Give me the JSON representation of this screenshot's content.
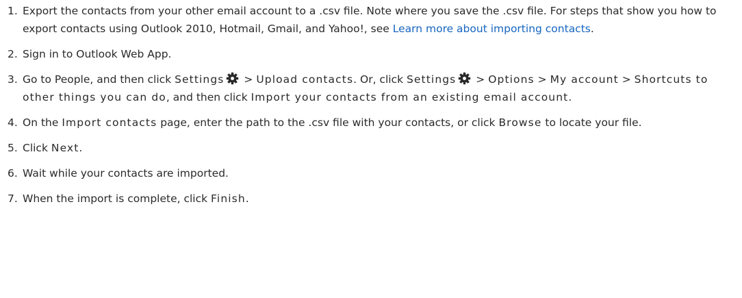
{
  "steps": [
    {
      "num": "1.",
      "text": "Export the contacts from your other email account to a .csv file. Note where you save the .csv file. For steps that show you how to export contacts using Outlook 2010, Hotmail, Gmail, and Yahoo!, see ",
      "link": "Learn more about importing contacts",
      "after": "."
    },
    {
      "num": "2.",
      "text": "Sign in to Outlook Web App."
    },
    {
      "num": "3.",
      "t1": "Go to People, and then click ",
      "settings": "Settings",
      "sep": " > ",
      "upload": "Upload contacts",
      "t2": ". Or, click ",
      "options": "Options",
      "myaccount": "My account",
      "shortcuts": "Shortcuts to other things you can do",
      "t3": ", and then click ",
      "import_link": "Import your contacts from an existing email account",
      "t4": "."
    },
    {
      "num": "4.",
      "t1": "On the ",
      "page": "Import contacts",
      "t2": " page, enter the path to the .csv file with your contacts, or click ",
      "browse": "Browse",
      "t3": " to locate your file."
    },
    {
      "num": "5.",
      "t1": "Click ",
      "next": "Next",
      "t2": "."
    },
    {
      "num": "6.",
      "text": "Wait while your contacts are imported."
    },
    {
      "num": "7.",
      "t1": "When the import is complete, click ",
      "finish": "Finish",
      "t2": "."
    }
  ],
  "icons": {
    "settings": "gear-icon"
  },
  "colors": {
    "link": "#1565c0",
    "text": "#2a2a2a"
  }
}
